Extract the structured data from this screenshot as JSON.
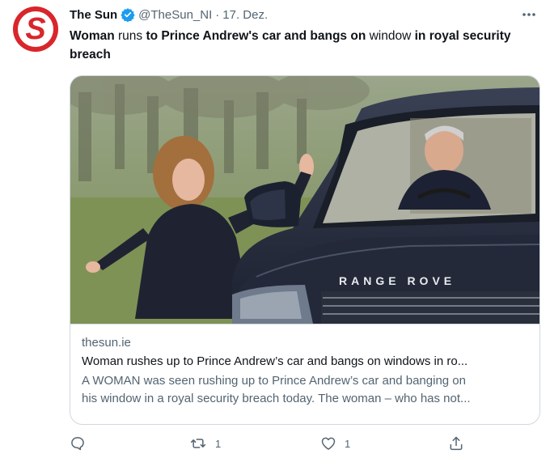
{
  "tweet": {
    "author_name": "The Sun",
    "author_handle": "@TheSun_NI",
    "separator": "·",
    "date": "17. Dez.",
    "avatar_icon": "the-sun-logo",
    "text_parts": [
      {
        "text": "Woman ",
        "weight": "bold"
      },
      {
        "text": "runs",
        "weight": "normal"
      },
      {
        "text": " to Prince Andrew's car and bangs on ",
        "weight": "bold"
      },
      {
        "text": "window",
        "weight": "normal"
      },
      {
        "text": " in royal security breach",
        "weight": "bold"
      }
    ]
  },
  "card": {
    "image_alt": "Woman reaching toward a dark Range Rover driven by Prince Andrew",
    "grille_text": "RANGE ROVE",
    "domain": "thesun.ie",
    "title": "Woman rushes up to Prince Andrew’s car and bangs on windows in ro...",
    "description_line1": "A WOMAN was seen rushing up to Prince Andrew’s car and banging on",
    "description_line2": "his window in a royal security breach today. The woman – who has not..."
  },
  "actions": {
    "reply_icon": "reply-icon",
    "retweet_icon": "retweet-icon",
    "retweet_count": "1",
    "like_icon": "heart-icon",
    "like_count": "1",
    "share_icon": "share-icon"
  },
  "colors": {
    "brand_red": "#d8262c",
    "verified_blue": "#1d9bf0",
    "secondary_text": "#536471",
    "border": "#cfd9de"
  }
}
